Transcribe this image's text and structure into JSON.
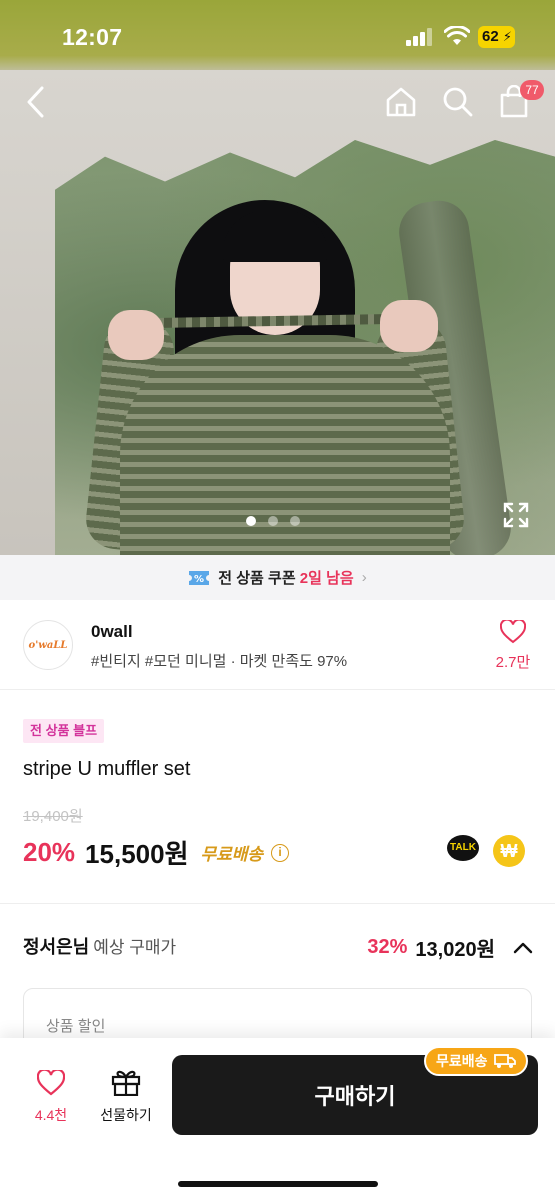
{
  "status_bar": {
    "time": "12:07",
    "battery": "62"
  },
  "nav": {
    "cart_count": "77"
  },
  "gallery": {
    "page_count": 3,
    "current_page": 1
  },
  "coupon": {
    "text": "전 상품 쿠폰",
    "highlight": "2일 남음"
  },
  "shop": {
    "name": "0wall",
    "logo_text": "o'waLL",
    "tags": "#빈티지 #모던 미니멀 · 마켓 만족도 97%",
    "likes": "2.7만"
  },
  "product": {
    "badge": "전 상품 블프",
    "title": "stripe U muffler set",
    "original_price": "19,400원",
    "discount": "20%",
    "price": "15,500원",
    "shipping": "무료배송",
    "talk_label": "TALK",
    "won_symbol": "₩"
  },
  "estimate": {
    "user": "정서은님",
    "label": "예상 구매가",
    "discount": "32%",
    "price": "13,020원"
  },
  "discount_card": {
    "title": "상품 할인"
  },
  "bottom_bar": {
    "wish_count": "4.4천",
    "gift_label": "선물하기",
    "buy_label": "구매하기",
    "ship_badge": "무료배송"
  },
  "colors": {
    "accent": "#e8335a",
    "shipping": "#d79a1a",
    "buy_button": "#1a1a1a",
    "ship_badge": "#f7a616"
  }
}
